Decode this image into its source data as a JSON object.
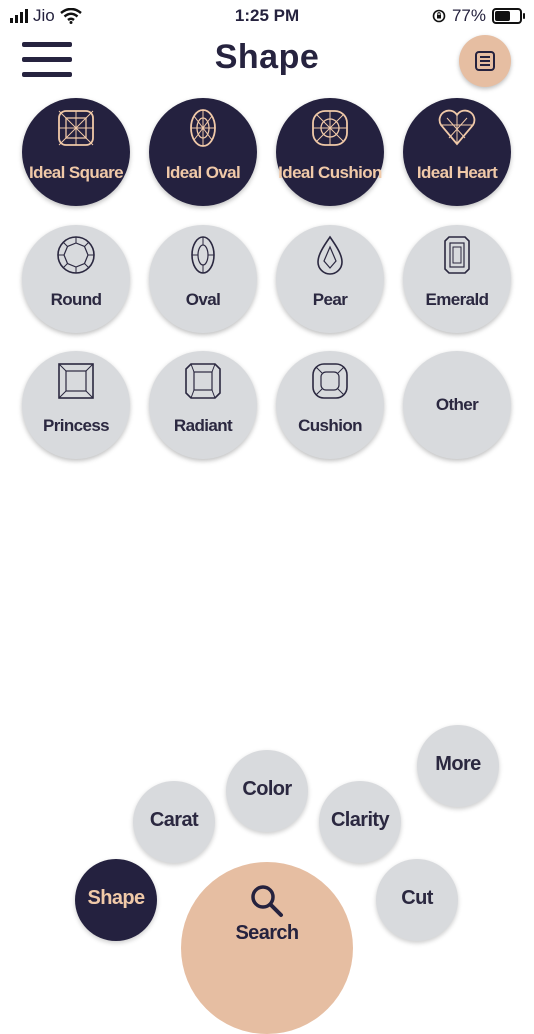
{
  "status_bar": {
    "carrier": "Jio",
    "time": "1:25 PM",
    "battery": "77%",
    "battery_level": 0.77
  },
  "header": {
    "title": "Shape"
  },
  "shapes": [
    {
      "label": "Ideal Square",
      "icon": "ideal-square-icon",
      "selected": true
    },
    {
      "label": "Ideal Oval",
      "icon": "ideal-oval-icon",
      "selected": true
    },
    {
      "label": "Ideal Cushion",
      "icon": "ideal-cushion-icon",
      "selected": true
    },
    {
      "label": "Ideal Heart",
      "icon": "ideal-heart-icon",
      "selected": true
    },
    {
      "label": "Round",
      "icon": "round-icon",
      "selected": false
    },
    {
      "label": "Oval",
      "icon": "oval-icon",
      "selected": false
    },
    {
      "label": "Pear",
      "icon": "pear-icon",
      "selected": false
    },
    {
      "label": "Emerald",
      "icon": "emerald-icon",
      "selected": false
    },
    {
      "label": "Princess",
      "icon": "princess-icon",
      "selected": false
    },
    {
      "label": "Radiant",
      "icon": "radiant-icon",
      "selected": false
    },
    {
      "label": "Cushion",
      "icon": "cushion-icon",
      "selected": false
    },
    {
      "label": "Other",
      "icon": "",
      "selected": false
    }
  ],
  "bottom_nav": {
    "shape": "Shape",
    "carat": "Carat",
    "color": "Color",
    "clarity": "Clarity",
    "more": "More",
    "cut": "Cut",
    "search": "Search"
  },
  "colors": {
    "navy": "#24213f",
    "peach": "#e6bea2",
    "light_gray": "#d8dadd",
    "accent_text": "#f0c9a8"
  }
}
